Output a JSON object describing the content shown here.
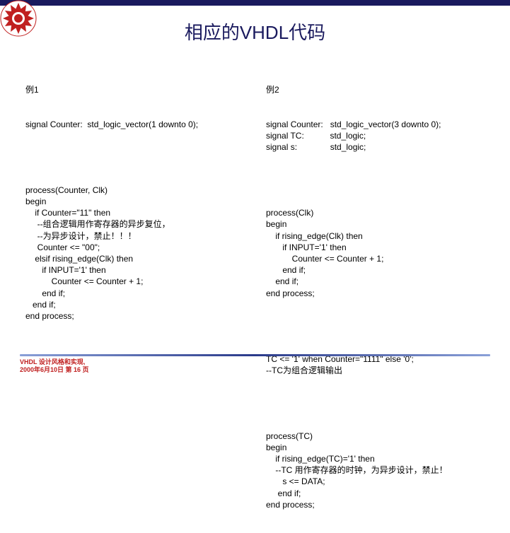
{
  "title": "相应的VHDL代码",
  "left": {
    "header": "例1",
    "sig": "signal Counter:  std_logic_vector(1 downto 0);",
    "block": "process(Counter, Clk)\nbegin\n    if Counter=\"11\" then\n     --组合逻辑用作寄存器的异步复位，\n     --为异步设计，禁止！！！\n     Counter <= \"00\";\n    elsif rising_edge(Clk) then\n       if INPUT='1' then\n           Counter <= Counter + 1;\n       end if;\n   end if;\nend process;"
  },
  "right": {
    "header": "例2",
    "sig": "signal Counter:   std_logic_vector(3 downto 0);\nsignal TC:           std_logic;\nsignal s:              std_logic;",
    "block1": "process(Clk)\nbegin\n    if rising_edge(Clk) then\n       if INPUT='1' then\n           Counter <= Counter + 1;\n       end if;\n    end if;\nend process;",
    "tc": "TC <= '1' when Counter=\"1111\" else '0';\n--TC为组合逻辑输出",
    "block2": "process(TC)\nbegin\n    if rising_edge(TC)='1' then\n    --TC 用作寄存器的时钟，为异步设计，禁止！\n       s <= DATA;\n     end if;\nend process;"
  },
  "footer": {
    "line1": "VHDL 设计风格和实现,",
    "line2": "2000年6月10日  第 16 页"
  }
}
